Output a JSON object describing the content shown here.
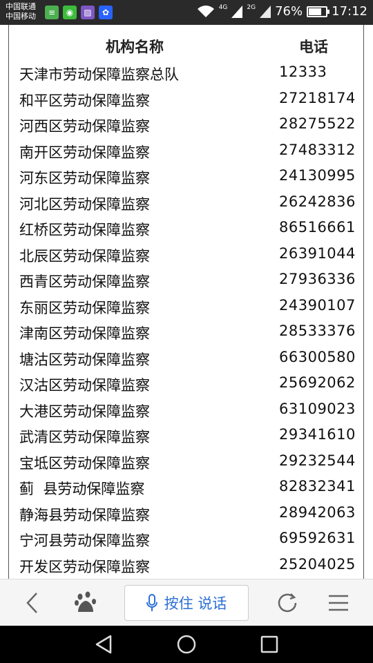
{
  "status_bar": {
    "carrier_1": "中国联通",
    "carrier_2": "中国移动",
    "net_1": "4G",
    "net_2": "2G",
    "battery_text": "76%",
    "battery_level": 0.76,
    "time": "17:12"
  },
  "table": {
    "headers": {
      "name": "机构名称",
      "phone": "电话"
    },
    "rows": [
      {
        "name": "天津市劳动保障监察总队",
        "phone": "12333"
      },
      {
        "name": "和平区劳动保障监察",
        "phone": "27218174"
      },
      {
        "name": "河西区劳动保障监察",
        "phone": "28275522"
      },
      {
        "name": "南开区劳动保障监察",
        "phone": "27483312"
      },
      {
        "name": "河东区劳动保障监察",
        "phone": "24130995"
      },
      {
        "name": "河北区劳动保障监察",
        "phone": "26242836"
      },
      {
        "name": "红桥区劳动保障监察",
        "phone": "86516661"
      },
      {
        "name": "北辰区劳动保障监察",
        "phone": "26391044"
      },
      {
        "name": "西青区劳动保障监察",
        "phone": "27936336"
      },
      {
        "name": "东丽区劳动保障监察",
        "phone": "24390107"
      },
      {
        "name": "津南区劳动保障监察",
        "phone": "28533376"
      },
      {
        "name": "塘沽区劳动保障监察",
        "phone": "66300580"
      },
      {
        "name": "汉沽区劳动保障监察",
        "phone": "25692062"
      },
      {
        "name": "大港区劳动保障监察",
        "phone": "63109023"
      },
      {
        "name": "武清区劳动保障监察",
        "phone": "29341610"
      },
      {
        "name": "宝坻区劳动保障监察",
        "phone": "29232544"
      },
      {
        "name": "蓟  县劳动保障监察",
        "phone": "82832341"
      },
      {
        "name": "静海县劳动保障监察",
        "phone": "28942063"
      },
      {
        "name": "宁河县劳动保障监察",
        "phone": "69592631"
      },
      {
        "name": "开发区劳动保障监察",
        "phone": "25204025"
      }
    ]
  },
  "toolbar": {
    "voice_label": "按住 说话",
    "accent": "#2b6fd6"
  }
}
